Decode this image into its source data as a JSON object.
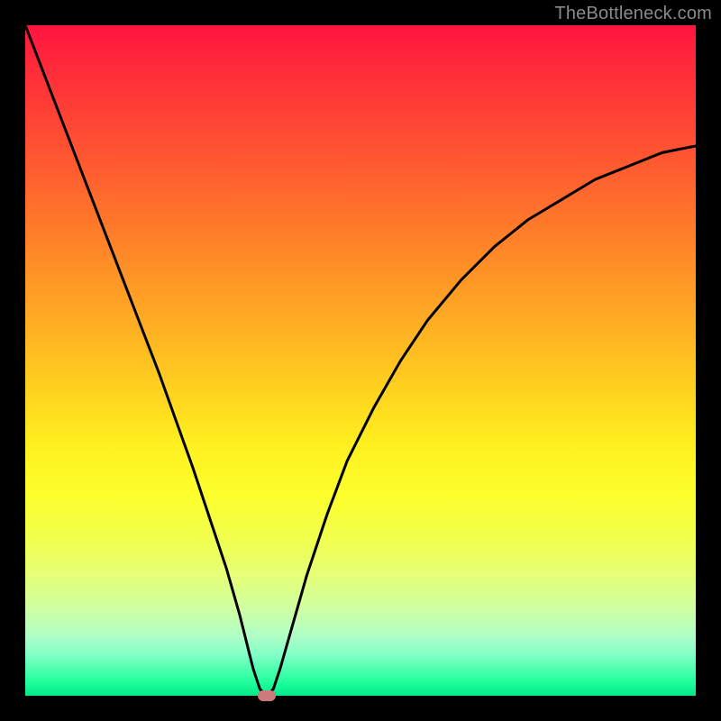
{
  "watermark": "TheBottleneck.com",
  "chart_data": {
    "type": "line",
    "title": "",
    "xlabel": "",
    "ylabel": "",
    "xlim": [
      0,
      100
    ],
    "ylim": [
      0,
      100
    ],
    "grid": false,
    "series": [
      {
        "name": "curve",
        "x": [
          0,
          5,
          10,
          15,
          20,
          25,
          28,
          30,
          32,
          33,
          34,
          35,
          36,
          37,
          38,
          40,
          42,
          45,
          48,
          52,
          56,
          60,
          65,
          70,
          75,
          80,
          85,
          90,
          95,
          100
        ],
        "values": [
          100,
          87,
          74,
          61,
          48,
          34,
          25,
          19,
          12,
          8,
          4,
          1,
          0,
          1,
          4,
          11,
          18,
          27,
          35,
          43,
          50,
          56,
          62,
          67,
          71,
          74,
          77,
          79,
          81,
          82
        ]
      }
    ],
    "marker": {
      "x": 36,
      "y": 0,
      "color": "#cc7a7a"
    },
    "background_gradient": {
      "top": "#ff143f",
      "bottom": "#05e889"
    }
  }
}
